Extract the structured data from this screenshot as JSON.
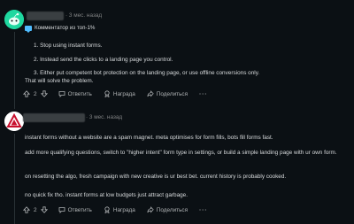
{
  "comment1": {
    "timestamp": "· 3 мес. назад",
    "flair": "Комментатор из топ-1%",
    "list": [
      "1. Stop using instant forms.",
      "2. Instead send the clicks to a landing page you control.",
      "3. Either put competent bot protection on the landing page, or use offline conversions only."
    ],
    "closing": "That will solve the problem.",
    "actions": {
      "score": "2",
      "reply": "Ответить",
      "award": "Награда",
      "share": "Поделиться",
      "more": "···"
    }
  },
  "comment2": {
    "timestamp": "· 3 мес. назад",
    "paragraphs": [
      "instant forms without a website are a spam magnet. meta optimises for form fills, bots fill forms fast.",
      "add more qualifying questions, switch to \"higher intent\" form type in settings, or build a simple landing page with ur own form.",
      "on resetting the algo, fresh campaign with new creative is ur best bet. current history is probably cooked.",
      "no quick fix tho. instant forms at low budgets just attract garbage."
    ],
    "actions": {
      "score": "2",
      "reply": "Ответить",
      "award": "Награда",
      "share": "Поделиться",
      "more": "···"
    }
  },
  "colors": {
    "background": "#0b1014",
    "text": "#d7dadc",
    "meta": "#818384",
    "flair": "#4fbcff",
    "avatar1": "#1fd8a0"
  }
}
